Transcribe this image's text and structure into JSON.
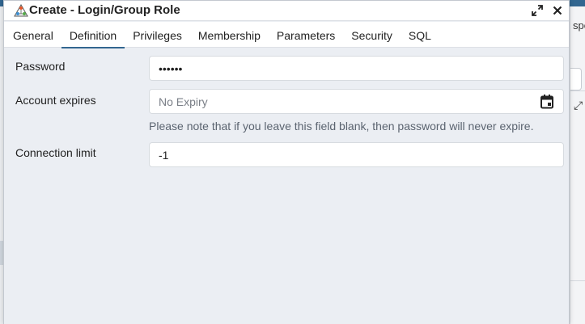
{
  "window": {
    "title": "Create - Login/Group Role"
  },
  "background": {
    "peek_text": "spo"
  },
  "tabs": [
    {
      "label": "General",
      "active": false
    },
    {
      "label": "Definition",
      "active": true
    },
    {
      "label": "Privileges",
      "active": false
    },
    {
      "label": "Membership",
      "active": false
    },
    {
      "label": "Parameters",
      "active": false
    },
    {
      "label": "Security",
      "active": false
    },
    {
      "label": "SQL",
      "active": false
    }
  ],
  "form": {
    "password": {
      "label": "Password",
      "value": "••••••"
    },
    "account_expires": {
      "label": "Account expires",
      "value": "",
      "placeholder": "No Expiry",
      "help": "Please note that if you leave this field blank, then password will never expire."
    },
    "connection_limit": {
      "label": "Connection limit",
      "value": "-1"
    }
  },
  "colors": {
    "accent": "#326690",
    "dialog_background": "#ebeef3",
    "help_text": "#5b6470"
  },
  "icons": {
    "app": "pgadmin-role-icon",
    "maximize": "expand-arrows-icon",
    "close": "close-icon",
    "calendar": "calendar-icon"
  }
}
